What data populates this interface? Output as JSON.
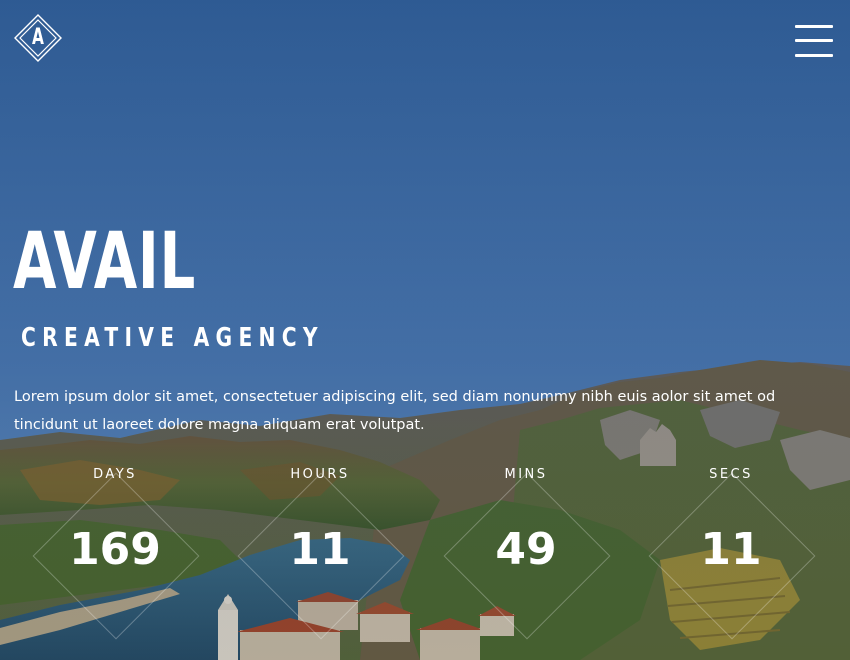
{
  "header": {
    "logo_letter": "A",
    "menu_icon": "hamburger-menu-icon"
  },
  "hero": {
    "title": "AVAIL",
    "subtitle": "CREATIVE AGENCY",
    "description": "Lorem ipsum dolor sit amet, consectetuer adipiscing elit, sed diam nonummy nibh euis aolor sit amet od tincidunt ut laoreet dolore magna aliquam erat volutpat."
  },
  "countdown": {
    "days_label": "DAYS",
    "days_value": "169",
    "hours_label": "HOURS",
    "hours_value": "11",
    "mins_label": "MINS",
    "mins_value": "49",
    "secs_label": "SECS",
    "secs_value": "11"
  },
  "colors": {
    "text": "#ffffff",
    "sky": "#3c6aa0",
    "diamond_line": "rgba(255,255,255,0.28)"
  }
}
